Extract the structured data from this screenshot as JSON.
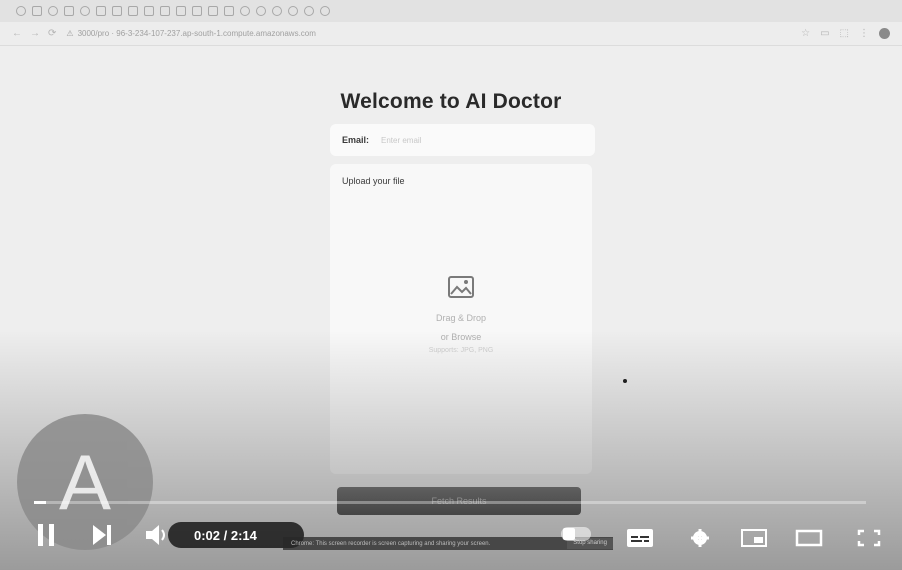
{
  "browser": {
    "url": "3000/pro · 96-3-234-107-237.ap-south-1.compute.amazonaws.com"
  },
  "page": {
    "title": "Welcome to AI Doctor",
    "email_label": "Email:",
    "email_placeholder": "Enter email",
    "upload_label": "Upload your file",
    "drop_line1": "Drag & Drop",
    "drop_line2": "or Browse",
    "drop_hint": "Supports: JPG, PNG",
    "submit_label": "Fetch Results"
  },
  "player": {
    "avatar_letter": "A",
    "time": "0:02 / 2:14",
    "progress_fraction": 0.015,
    "caption_text": "Chrome: This screen recorder is screen capturing and sharing your screen.",
    "caption_button": "Stop sharing"
  },
  "colors": {
    "page_bg": "#eeeeee",
    "button_bg": "#6b6b6b",
    "title_color": "#2a2a2a"
  }
}
